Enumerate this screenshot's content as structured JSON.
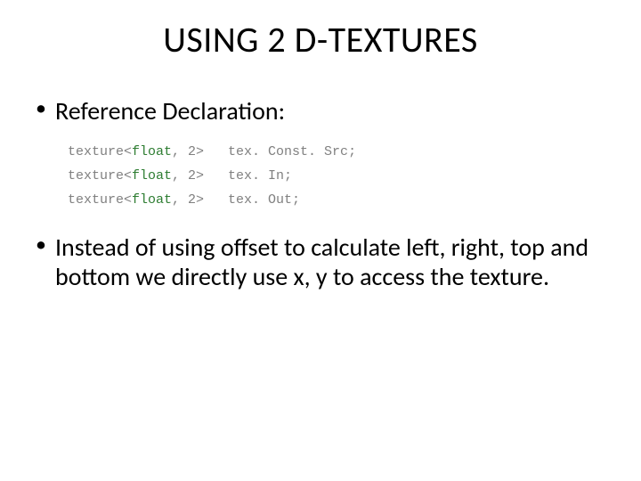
{
  "title": "USING 2 D-TEXTURES",
  "bullets": {
    "b1": "Reference Declaration:",
    "b2": "Instead of using offset to calculate left, right, top and bottom we directly use x, y to access the texture."
  },
  "code": {
    "l1a": "texture<",
    "l1b": "float",
    "l1c": ", 2>   tex. Const. Src;",
    "l2a": "texture<",
    "l2b": "float",
    "l2c": ", 2>   tex. In;",
    "l3a": "texture<",
    "l3b": "float",
    "l3c": ", 2>   tex. Out;"
  }
}
